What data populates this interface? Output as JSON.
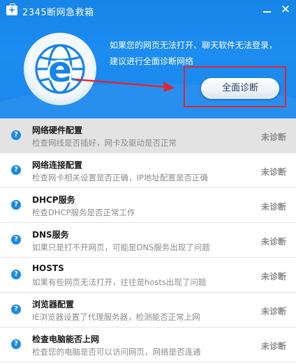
{
  "window": {
    "title": "2345断网急救箱",
    "minimize_label": "—",
    "close_label": "✕"
  },
  "banner": {
    "line1": "如果您的网页无法打开、聊天软件无法登录，",
    "line2": "建议进行全面诊断网络",
    "diagnose_button": "全面诊断"
  },
  "colors": {
    "banner_blue": "#1c8cf0",
    "highlight_red": "#e0262e",
    "icon_blue": "#1a8ae6"
  },
  "items": [
    {
      "title": "网络硬件配置",
      "desc": "检查网线是否插好，网卡及驱动是否正常",
      "status": "未诊断",
      "icon": "question-icon"
    },
    {
      "title": "网络连接配置",
      "desc": "检查网卡相关设置是否正确，IP地址配置是否正确",
      "status": "未诊断",
      "icon": "question-icon"
    },
    {
      "title": "DHCP服务",
      "desc": "检查DHCP服务是否正常工作",
      "status": "未诊断",
      "icon": "question-icon"
    },
    {
      "title": "DNS服务",
      "desc": "如果只是打不开网页，可能是DNS服务出现了问题",
      "status": "未诊断",
      "icon": "question-icon"
    },
    {
      "title": "HOSTS",
      "desc": "如果有些网页无法打开，往往是hosts出现了问题",
      "status": "未诊断",
      "icon": "question-icon"
    },
    {
      "title": "浏览器配置",
      "desc": "IE浏览器设置了代理服务器，检测能否正常上网",
      "status": "未诊断",
      "icon": "question-icon"
    },
    {
      "title": "检查电脑能否上网",
      "desc": "检查您的电脑是否可以访问网页，网络是否连通",
      "status": "未诊断",
      "icon": "question-icon"
    }
  ]
}
